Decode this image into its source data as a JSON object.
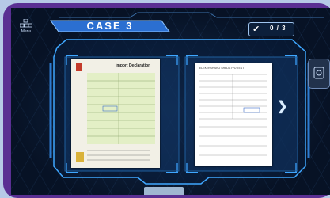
{
  "menu": {
    "label": "Menu",
    "icon": "menu-grid-icon"
  },
  "case": {
    "title": "CASE 3"
  },
  "progress": {
    "icon": "checkmark-icon",
    "count": "0 / 3"
  },
  "side_panel": {
    "icon": "tool-icon"
  },
  "documents": {
    "left": {
      "title": "Import Declaration",
      "bg": "#f2f0e6"
    },
    "right": {
      "title": "ELEKTRONSKO SREDSTVO TEST",
      "bg": "#ffffff"
    }
  },
  "navigation": {
    "next_icon": "chevron-right-icon"
  },
  "colors": {
    "frame": "#5a2f93",
    "screen": "#071225",
    "accent": "#3fa7ff",
    "banner": "#2b6fd1"
  }
}
